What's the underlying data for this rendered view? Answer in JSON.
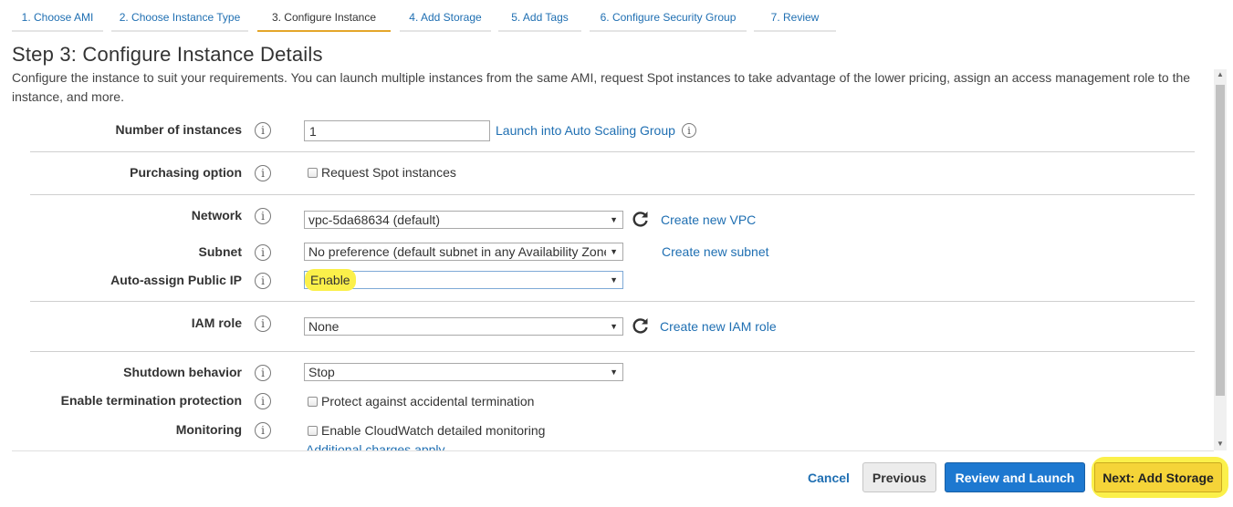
{
  "tabs": [
    {
      "label": "1. Choose AMI"
    },
    {
      "label": "2. Choose Instance Type"
    },
    {
      "label": "3. Configure Instance"
    },
    {
      "label": "4. Add Storage"
    },
    {
      "label": "5. Add Tags"
    },
    {
      "label": "6. Configure Security Group"
    },
    {
      "label": "7. Review"
    }
  ],
  "page": {
    "title": "Step 3: Configure Instance Details",
    "description": "Configure the instance to suit your requirements. You can launch multiple instances from the same AMI, request Spot instances to take advantage of the lower pricing, assign an access management role to the instance, and more."
  },
  "info_glyph": "i",
  "fields": {
    "instances": {
      "label": "Number of instances",
      "value": "1",
      "link": "Launch into Auto Scaling Group"
    },
    "purchasing": {
      "label": "Purchasing option",
      "checkbox": "Request Spot instances"
    },
    "network": {
      "label": "Network",
      "value": "vpc-5da68634 (default)",
      "link": "Create new VPC"
    },
    "subnet": {
      "label": "Subnet",
      "value": "No preference (default subnet in any Availability Zone)",
      "link": "Create new subnet"
    },
    "public_ip": {
      "label": "Auto-assign Public IP",
      "value": "Enable"
    },
    "iam": {
      "label": "IAM role",
      "value": "None",
      "link": "Create new IAM role"
    },
    "shutdown": {
      "label": "Shutdown behavior",
      "value": "Stop"
    },
    "termination": {
      "label": "Enable termination protection",
      "checkbox": "Protect against accidental termination"
    },
    "monitoring": {
      "label": "Monitoring",
      "checkbox": "Enable CloudWatch detailed monitoring",
      "note": "Additional charges apply"
    }
  },
  "footer": {
    "cancel": "Cancel",
    "previous": "Previous",
    "review": "Review and Launch",
    "next": "Next: Add Storage"
  },
  "colors": {
    "link": "#1f6fb2",
    "active_tab_underline": "#e4a62a",
    "primary_button": "#1d78d0",
    "next_button": "#f5d438",
    "highlight": "#fbf04a"
  }
}
